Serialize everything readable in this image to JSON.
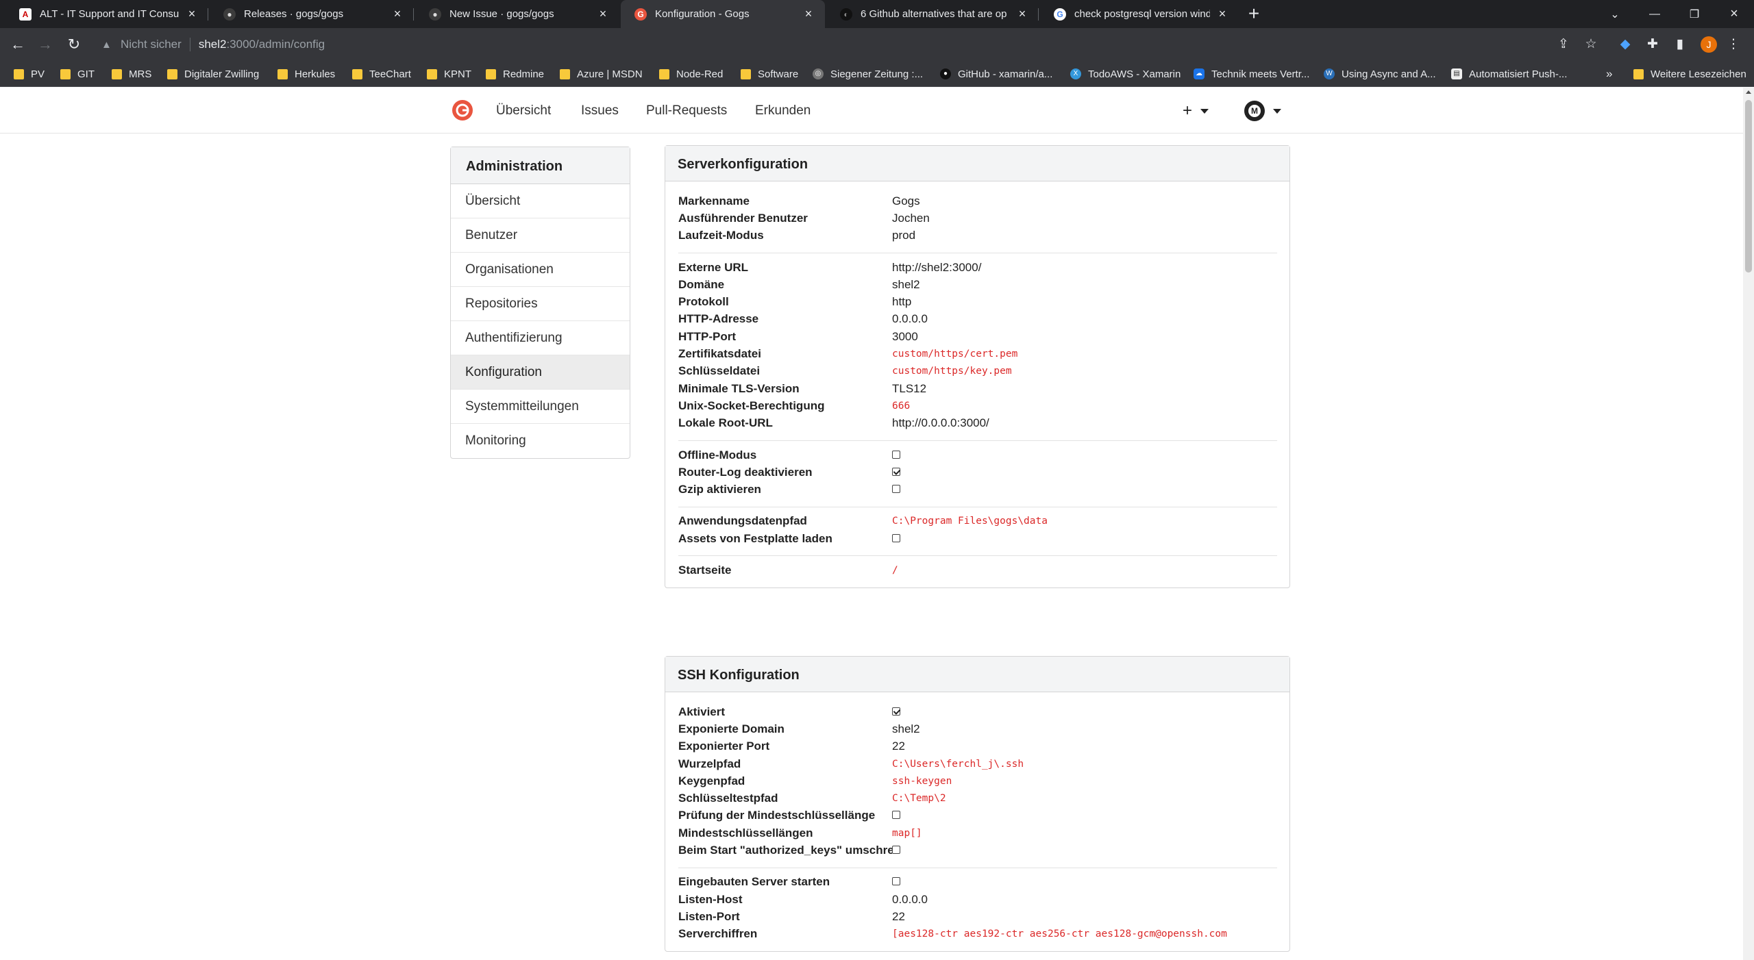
{
  "browser": {
    "tabs": [
      {
        "title": "ALT - IT Support and IT Consultin",
        "active": false
      },
      {
        "title": "Releases · gogs/gogs",
        "active": false
      },
      {
        "title": "New Issue · gogs/gogs",
        "active": false
      },
      {
        "title": "Konfiguration - Gogs",
        "active": true
      },
      {
        "title": "6 Github alternatives that are op",
        "active": false
      },
      {
        "title": "check postgresql version window",
        "active": false
      }
    ],
    "address": {
      "security_label": "Nicht sicher",
      "host": "shel2",
      "path": ":3000/admin/config"
    },
    "profile_initial": "J",
    "bookmarks": [
      {
        "label": "PV",
        "type": "folder"
      },
      {
        "label": "GIT",
        "type": "folder"
      },
      {
        "label": "MRS",
        "type": "folder"
      },
      {
        "label": "Digitaler Zwilling",
        "type": "folder"
      },
      {
        "label": "Herkules",
        "type": "folder"
      },
      {
        "label": "TeeChart",
        "type": "folder"
      },
      {
        "label": "KPNT",
        "type": "folder"
      },
      {
        "label": "Redmine",
        "type": "folder"
      },
      {
        "label": "Azure | MSDN",
        "type": "folder"
      },
      {
        "label": "Node-Red",
        "type": "folder"
      },
      {
        "label": "Software",
        "type": "folder"
      },
      {
        "label": "Siegener Zeitung :...",
        "type": "site"
      },
      {
        "label": "GitHub - xamarin/a...",
        "type": "site"
      },
      {
        "label": "TodoAWS - Xamarin",
        "type": "site"
      },
      {
        "label": "Technik meets Vertr...",
        "type": "site"
      },
      {
        "label": "Using Async and A...",
        "type": "site"
      },
      {
        "label": "Automatisiert Push-...",
        "type": "site"
      }
    ],
    "bookmarks_more": "»",
    "other_bookmarks": "Weitere Lesezeichen"
  },
  "colors": {
    "accent": "#db2828",
    "chrome_dark": "#202124",
    "chrome_toolbar": "#35363a",
    "logo": "#e9553f"
  },
  "nav": {
    "items": [
      "Übersicht",
      "Issues",
      "Pull-Requests",
      "Erkunden"
    ],
    "plus": "+",
    "user_initials": "M"
  },
  "sidebar": {
    "title": "Administration",
    "items": [
      {
        "label": "Übersicht",
        "active": false
      },
      {
        "label": "Benutzer",
        "active": false
      },
      {
        "label": "Organisationen",
        "active": false
      },
      {
        "label": "Repositories",
        "active": false
      },
      {
        "label": "Authentifizierung",
        "active": false
      },
      {
        "label": "Konfiguration",
        "active": true
      },
      {
        "label": "Systemmitteilungen",
        "active": false
      },
      {
        "label": "Monitoring",
        "active": false
      }
    ]
  },
  "server": {
    "title": "Serverkonfiguration",
    "groups": [
      [
        {
          "k": "Markenname",
          "v": "Gogs"
        },
        {
          "k": "Ausführender Benutzer",
          "v": "Jochen"
        },
        {
          "k": "Laufzeit-Modus",
          "v": "prod"
        }
      ],
      [
        {
          "k": "Externe URL",
          "v": "http://shel2:3000/"
        },
        {
          "k": "Domäne",
          "v": "shel2"
        },
        {
          "k": "Protokoll",
          "v": "http"
        },
        {
          "k": "HTTP-Adresse",
          "v": "0.0.0.0"
        },
        {
          "k": "HTTP-Port",
          "v": "3000"
        },
        {
          "k": "Zertifikatsdatei",
          "v": "custom/https/cert.pem",
          "code": true
        },
        {
          "k": "Schlüsseldatei",
          "v": "custom/https/key.pem",
          "code": true
        },
        {
          "k": "Minimale TLS-Version",
          "v": "TLS12"
        },
        {
          "k": "Unix-Socket-Berechtigung",
          "v": "666",
          "code": true
        },
        {
          "k": "Lokale Root-URL",
          "v": "http://0.0.0.0:3000/"
        }
      ],
      [
        {
          "k": "Offline-Modus",
          "check": false
        },
        {
          "k": "Router-Log deaktivieren",
          "check": true
        },
        {
          "k": "Gzip aktivieren",
          "check": false
        }
      ],
      [
        {
          "k": "Anwendungsdatenpfad",
          "v": "C:\\Program Files\\gogs\\data",
          "code": true
        },
        {
          "k": "Assets von Festplatte laden",
          "check": false
        }
      ],
      [
        {
          "k": "Startseite",
          "v": "/",
          "code": true
        }
      ]
    ]
  },
  "ssh": {
    "title": "SSH Konfiguration",
    "groups": [
      [
        {
          "k": "Aktiviert",
          "check": true
        },
        {
          "k": "Exponierte Domain",
          "v": "shel2"
        },
        {
          "k": "Exponierter Port",
          "v": "22"
        },
        {
          "k": "Wurzelpfad",
          "v": "C:\\Users\\ferchl_j\\.ssh",
          "code": true
        },
        {
          "k": "Keygenpfad",
          "v": "ssh-keygen",
          "code": true
        },
        {
          "k": "Schlüsseltestpfad",
          "v": "C:\\Temp\\2",
          "code": true
        },
        {
          "k": "Prüfung der Mindestschlüssellänge",
          "check": false
        },
        {
          "k": "Mindestschlüssellängen",
          "v": "map[]",
          "code": true
        },
        {
          "k": "Beim Start \"authorized_keys\" umschreiben",
          "check": false
        }
      ],
      [
        {
          "k": "Eingebauten Server starten",
          "check": false
        },
        {
          "k": "Listen-Host",
          "v": "0.0.0.0"
        },
        {
          "k": "Listen-Port",
          "v": "22"
        },
        {
          "k": "Serverchiffren",
          "v": "[aes128-ctr aes192-ctr aes256-ctr aes128-gcm@openssh.com",
          "code": true
        }
      ]
    ]
  }
}
